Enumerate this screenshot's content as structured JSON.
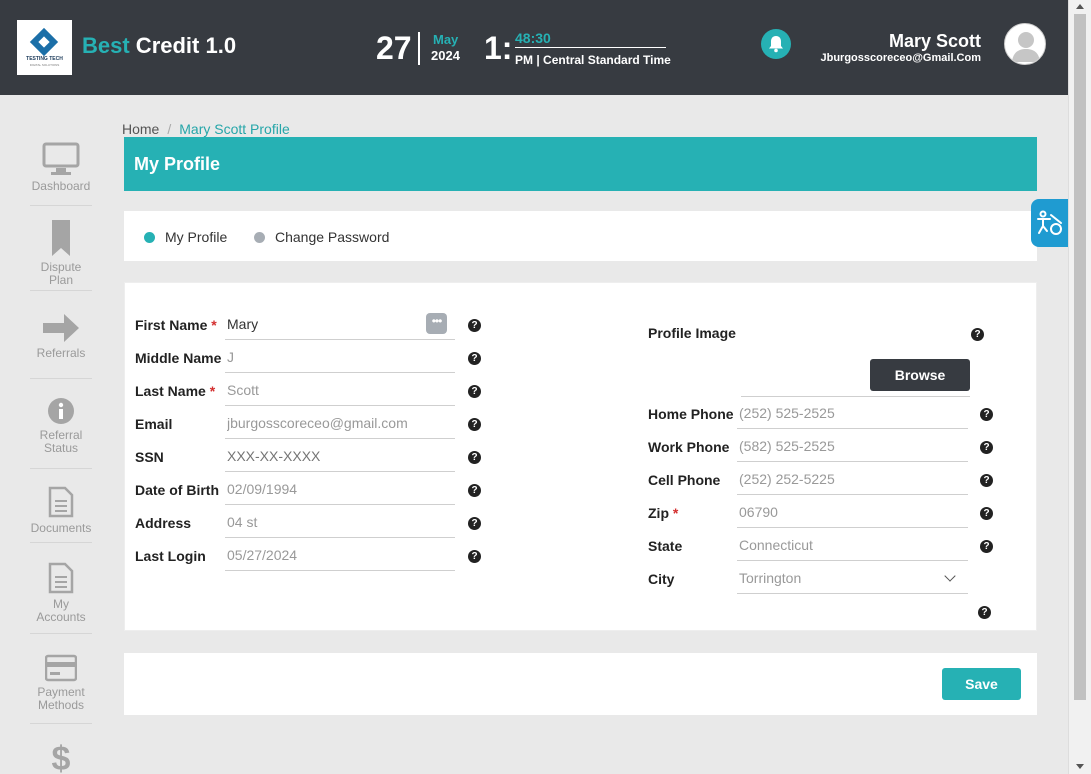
{
  "header": {
    "logo_text": "TESTING TECH",
    "logo_sub": "DIGITAL SOLUTIONS",
    "app_name_accent": "Best",
    "app_name_rest": " Credit 1.0",
    "date_day": "27",
    "date_month": "May",
    "date_year": "2024",
    "time_hour": "1:",
    "time_minutes": "48:30",
    "time_period_zone": "PM | Central Standard Time",
    "user_name": "Mary Scott",
    "user_email": "Jburgosscoreceo@Gmail.Com",
    "bell_icon": "bell-icon",
    "avatar_icon": "user-avatar-icon"
  },
  "sidebar": {
    "items": [
      {
        "label": "Dashboard",
        "icon": "monitor-icon"
      },
      {
        "label": "Dispute Plan",
        "icon": "bookmark-icon"
      },
      {
        "label": "Referrals",
        "icon": "arrow-right-icon"
      },
      {
        "label": "Referral Status",
        "icon": "info-icon"
      },
      {
        "label": "Documents",
        "icon": "document-icon"
      },
      {
        "label": "My Accounts",
        "icon": "document-icon"
      },
      {
        "label": "Payment Methods",
        "icon": "credit-card-icon"
      },
      {
        "label": "",
        "icon": "dollar-icon"
      }
    ]
  },
  "breadcrumb": {
    "home": "Home",
    "separator": "/",
    "current": "Mary Scott Profile"
  },
  "page_title": "My Profile",
  "tabs": [
    {
      "label": "My Profile",
      "active": true,
      "color": "#26b1b4"
    },
    {
      "label": "Change Password",
      "active": false,
      "color": "#a7adb4"
    }
  ],
  "form_left": {
    "first_name_label": "First Name",
    "first_name_value": "Mary",
    "middle_name_label": "Middle Name",
    "middle_name_value": "J",
    "last_name_label": "Last Name",
    "last_name_value": "Scott",
    "email_label": "Email",
    "email_value": "jburgosscoreceo@gmail.com",
    "ssn_label": "SSN",
    "ssn_placeholder": "XXX-XX-XXXX",
    "dob_label": "Date of Birth",
    "dob_value": "02/09/1994",
    "address_label": "Address",
    "address_value": "04 st",
    "last_login_label": "Last Login",
    "last_login_value": "05/27/2024",
    "required_mark": "*"
  },
  "form_right": {
    "profile_image_label": "Profile Image",
    "browse_label": "Browse",
    "home_phone_label": "Home Phone",
    "home_phone_value": "(252) 525-2525",
    "work_phone_label": "Work Phone",
    "work_phone_value": "(582) 525-2525",
    "cell_phone_label": "Cell Phone",
    "cell_phone_value": "(252) 252-5225",
    "zip_label": "Zip",
    "zip_value": "06790",
    "state_label": "State",
    "state_value": "Connecticut",
    "city_label": "City",
    "city_value": "Torrington"
  },
  "help_glyph": "?",
  "dots_glyph": "•••",
  "save_label": "Save",
  "colors": {
    "accent": "#26b1b4",
    "header_bg": "#373b41",
    "required": "#d32f2f"
  }
}
